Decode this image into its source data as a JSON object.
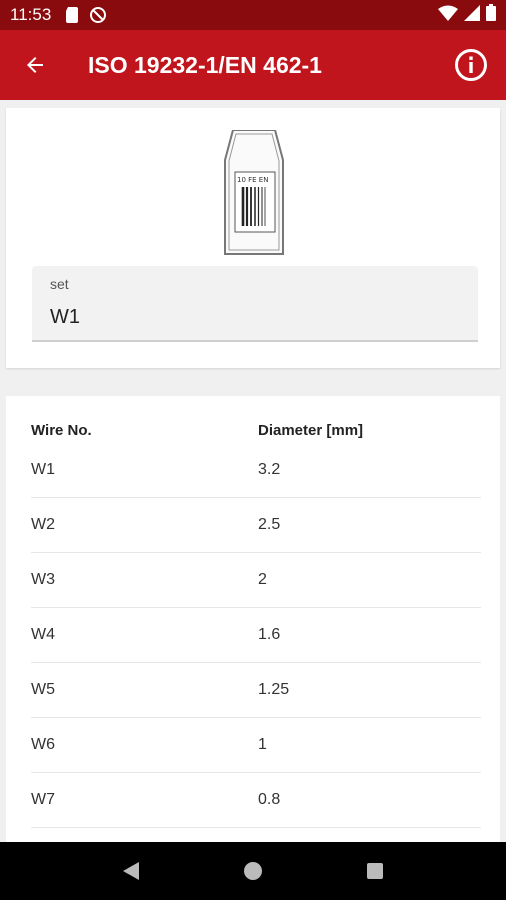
{
  "status": {
    "time": "11:53"
  },
  "appbar": {
    "title": "ISO 19232-1/EN 462-1"
  },
  "image": {
    "plate_text": "10 FE EN"
  },
  "set_field": {
    "label": "set",
    "value": "W1"
  },
  "table": {
    "headers": [
      "Wire No.",
      "Diameter [mm]"
    ],
    "rows": [
      {
        "wire": "W1",
        "diameter": "3.2"
      },
      {
        "wire": "W2",
        "diameter": "2.5"
      },
      {
        "wire": "W3",
        "diameter": "2"
      },
      {
        "wire": "W4",
        "diameter": "1.6"
      },
      {
        "wire": "W5",
        "diameter": "1.25"
      },
      {
        "wire": "W6",
        "diameter": "1"
      },
      {
        "wire": "W7",
        "diameter": "0.8"
      }
    ]
  },
  "colors": {
    "status_bar": "#8a0b0d",
    "app_bar": "#c0151c",
    "nav_bar": "#000000"
  }
}
